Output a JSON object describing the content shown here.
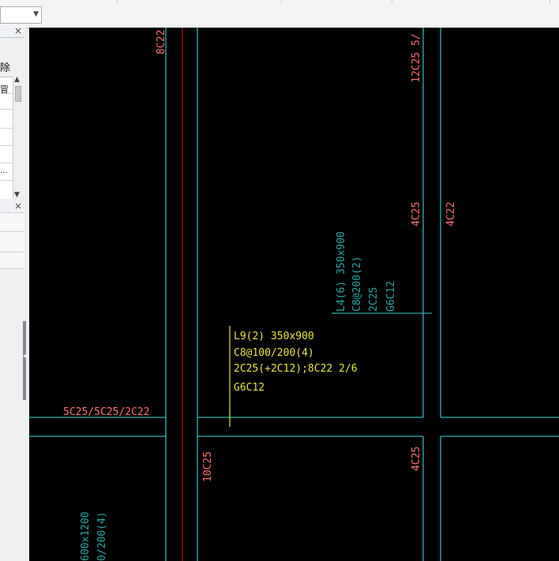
{
  "colors": {
    "axis_cyan": "#2ab7b7",
    "rebar_red": "#ff7070",
    "dark_red": "#b01010",
    "label_yellow": "#e8e840",
    "beam_cyan": "#2ea6a6"
  },
  "left_panel": {
    "delete_label": "除",
    "header_cell": "冒",
    "ellipsis": "..."
  },
  "drawing": {
    "col_top_label": "8C22",
    "right_top_label": "12C25 5/",
    "mid_left_rebar": "4C25",
    "mid_right_rebar": "4C22",
    "l4_lines": [
      "L4(6) 350x900",
      "C8@200(2)",
      "2C25",
      "G6C12"
    ],
    "l9_lines": [
      "L9(2) 350x900",
      "C8@100/200(4)",
      "2C25(+2C12);8C22 2/6",
      "G6C12"
    ],
    "left_beam_label": "5C25/5C25/2C22",
    "lower_col_label": "10C25",
    "lower_right_rebar": "4C25",
    "bottom_left_lines": [
      "600x1200",
      "0/200(4)"
    ]
  }
}
